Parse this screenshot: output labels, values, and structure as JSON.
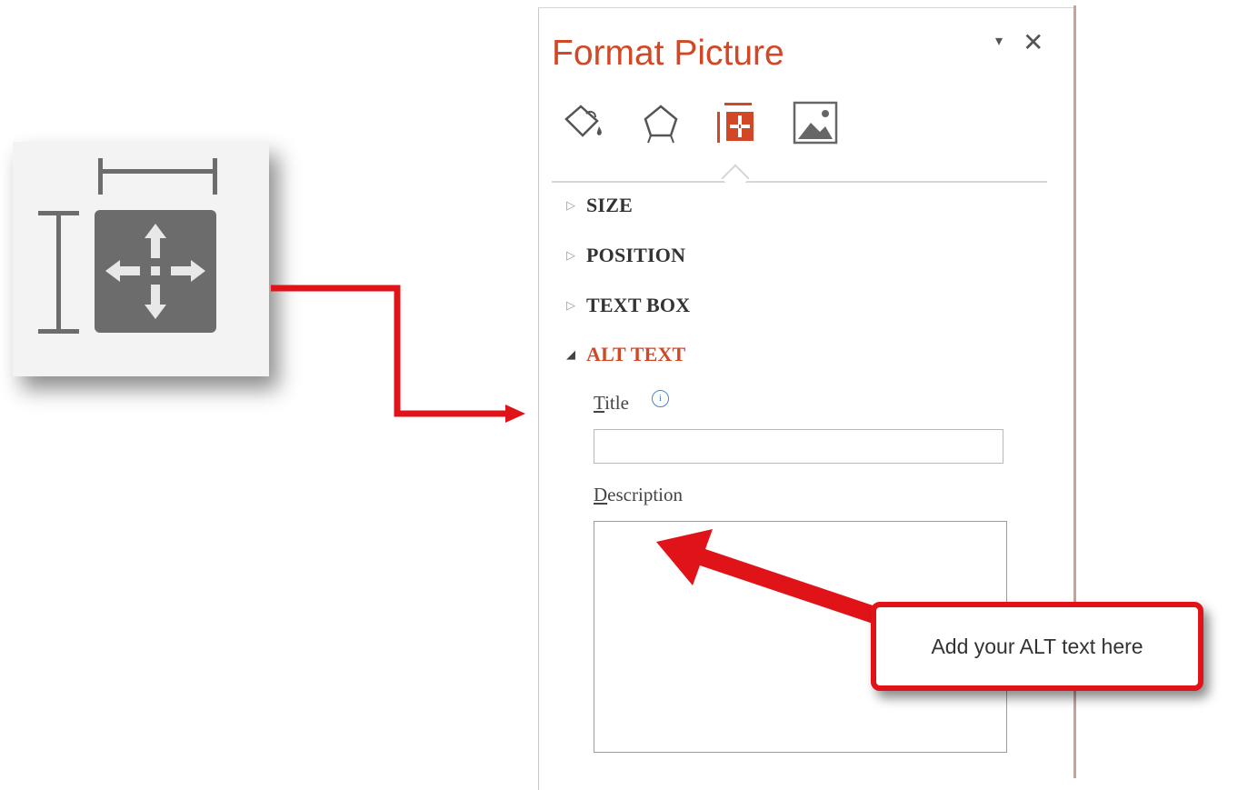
{
  "pane": {
    "title": "Format Picture",
    "menu_glyph": "▾",
    "close_glyph": "✕",
    "tabs": [
      {
        "name": "fill-line-icon"
      },
      {
        "name": "effects-icon"
      },
      {
        "name": "size-properties-icon",
        "active": true
      },
      {
        "name": "picture-icon"
      }
    ],
    "sections": [
      {
        "label": "SIZE",
        "expanded": false
      },
      {
        "label": "POSITION",
        "expanded": false
      },
      {
        "label": "TEXT BOX",
        "expanded": false
      },
      {
        "label": "ALT TEXT",
        "expanded": true
      }
    ],
    "alt_text": {
      "title_label_first": "T",
      "title_label_rest": "itle",
      "info_glyph": "i",
      "title_value": "",
      "description_label_first": "D",
      "description_label_rest": "escription",
      "description_value": ""
    }
  },
  "callout": {
    "text": "Add your ALT text here"
  },
  "colors": {
    "accent": "#d24726",
    "annotation_red": "#e01418"
  }
}
